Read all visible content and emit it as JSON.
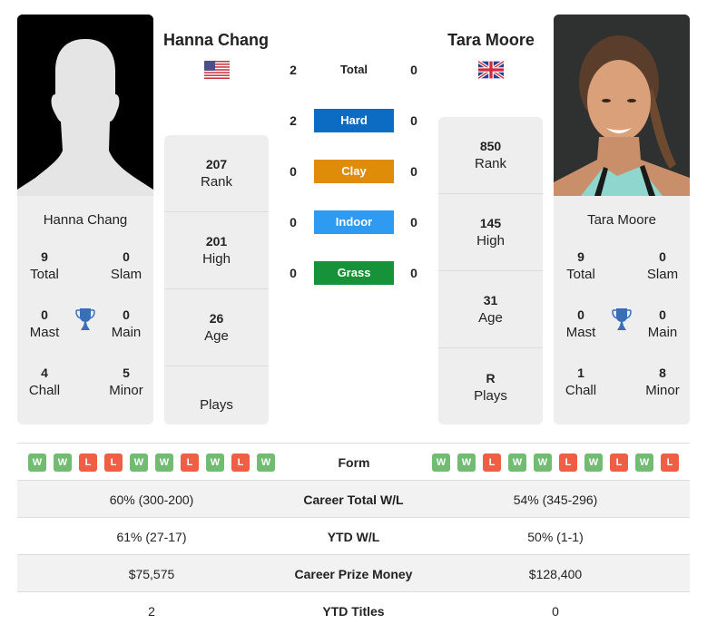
{
  "player1": {
    "name": "Hanna Chang",
    "flag": "usa-flag",
    "photo": "silhouette-placeholder",
    "card_name": "Hanna Chang",
    "titles": {
      "total": {
        "value": "9",
        "label": "Total"
      },
      "slam": {
        "value": "0",
        "label": "Slam"
      },
      "mast": {
        "value": "0",
        "label": "Mast"
      },
      "main": {
        "value": "0",
        "label": "Main"
      },
      "chall": {
        "value": "4",
        "label": "Chall"
      },
      "minor": {
        "value": "5",
        "label": "Minor"
      }
    },
    "stats": {
      "rank": {
        "value": "207",
        "label": "Rank"
      },
      "high": {
        "value": "201",
        "label": "High"
      },
      "age": {
        "value": "26",
        "label": "Age"
      },
      "plays": {
        "value": "",
        "label": "Plays"
      }
    },
    "form": [
      "W",
      "W",
      "L",
      "L",
      "W",
      "W",
      "L",
      "W",
      "L",
      "W"
    ],
    "career_total_wl": "60% (300-200)",
    "ytd_wl": "61% (27-17)",
    "career_prize_money": "$75,575",
    "ytd_titles": "2"
  },
  "player2": {
    "name": "Tara Moore",
    "flag": "uk-flag",
    "photo": "player-photo",
    "card_name": "Tara Moore",
    "titles": {
      "total": {
        "value": "9",
        "label": "Total"
      },
      "slam": {
        "value": "0",
        "label": "Slam"
      },
      "mast": {
        "value": "0",
        "label": "Mast"
      },
      "main": {
        "value": "0",
        "label": "Main"
      },
      "chall": {
        "value": "1",
        "label": "Chall"
      },
      "minor": {
        "value": "8",
        "label": "Minor"
      }
    },
    "stats": {
      "rank": {
        "value": "850",
        "label": "Rank"
      },
      "high": {
        "value": "145",
        "label": "High"
      },
      "age": {
        "value": "31",
        "label": "Age"
      },
      "plays": {
        "value": "R",
        "label": "Plays"
      }
    },
    "form": [
      "W",
      "W",
      "L",
      "W",
      "W",
      "L",
      "W",
      "L",
      "W",
      "L"
    ],
    "career_total_wl": "54% (345-296)",
    "ytd_wl": "50% (1-1)",
    "career_prize_money": "$128,400",
    "ytd_titles": "0"
  },
  "h2h": [
    {
      "label": "Total",
      "p1": "2",
      "p2": "0",
      "color": ""
    },
    {
      "label": "Hard",
      "p1": "2",
      "p2": "0",
      "color": "#0c6cc4"
    },
    {
      "label": "Clay",
      "p1": "0",
      "p2": "0",
      "color": "#de8c0a"
    },
    {
      "label": "Indoor",
      "p1": "0",
      "p2": "0",
      "color": "#2e9af2"
    },
    {
      "label": "Grass",
      "p1": "0",
      "p2": "0",
      "color": "#169238"
    }
  ],
  "comparison": {
    "form_label": "Form",
    "career_total_wl_label": "Career Total W/L",
    "ytd_wl_label": "YTD W/L",
    "career_prize_money_label": "Career Prize Money",
    "ytd_titles_label": "YTD Titles"
  },
  "icons": {
    "trophy": "trophy-icon",
    "trophy_color": "#3a6fb8"
  }
}
